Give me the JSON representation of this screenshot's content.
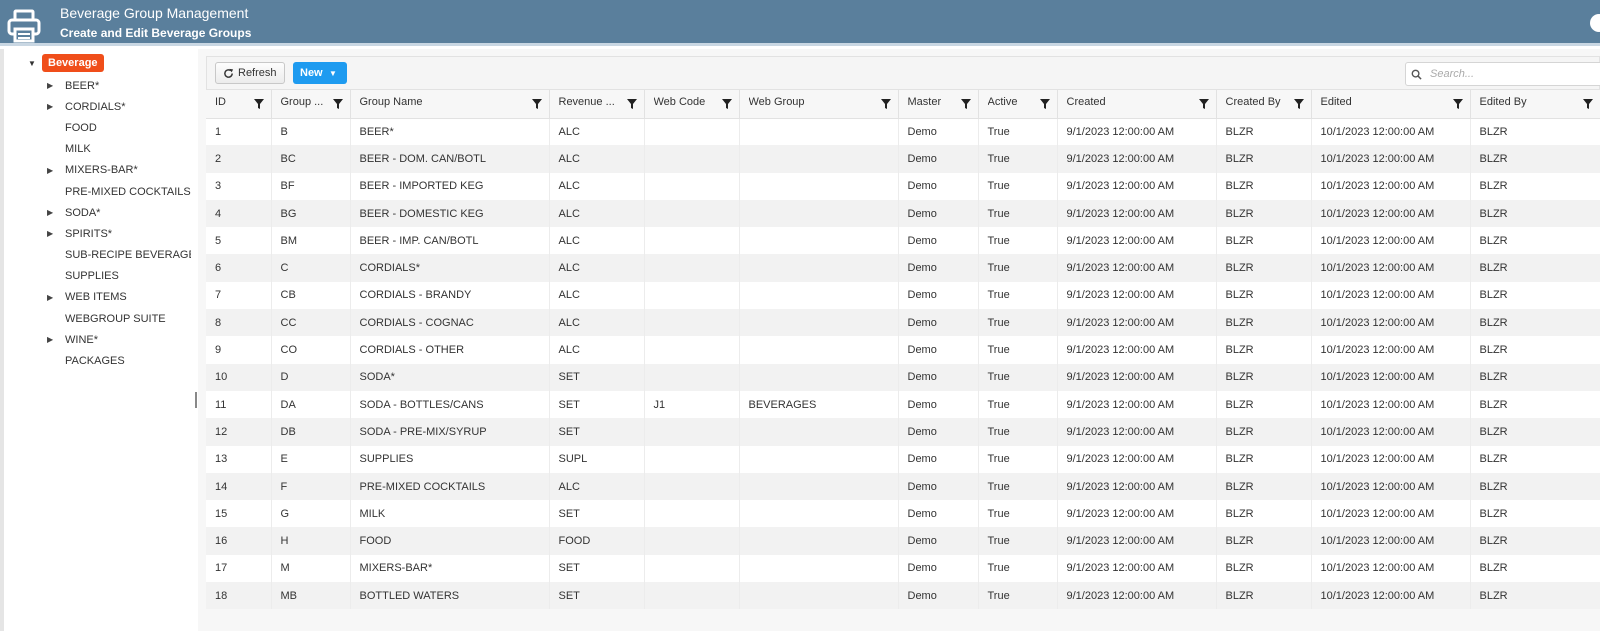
{
  "header": {
    "title": "Beverage Group Management",
    "subtitle": "Create and Edit Beverage Groups"
  },
  "tree": {
    "root_label": "Beverage",
    "items": [
      {
        "label": "BEER*",
        "expandable": true
      },
      {
        "label": "CORDIALS*",
        "expandable": true
      },
      {
        "label": "FOOD",
        "expandable": false
      },
      {
        "label": "MILK",
        "expandable": false
      },
      {
        "label": "MIXERS-BAR*",
        "expandable": true
      },
      {
        "label": "PRE-MIXED COCKTAILS",
        "expandable": false
      },
      {
        "label": "SODA*",
        "expandable": true
      },
      {
        "label": "SPIRITS*",
        "expandable": true
      },
      {
        "label": "SUB-RECIPE BEVERAGES",
        "expandable": false
      },
      {
        "label": "SUPPLIES",
        "expandable": false
      },
      {
        "label": "WEB ITEMS",
        "expandable": true
      },
      {
        "label": "WEBGROUP SUITE",
        "expandable": false
      },
      {
        "label": "WINE*",
        "expandable": true
      },
      {
        "label": "PACKAGES",
        "expandable": false
      }
    ]
  },
  "toolbar": {
    "refresh_label": "Refresh",
    "new_label": "New",
    "search_placeholder": "Search..."
  },
  "table": {
    "columns": [
      "ID",
      "Group ...",
      "Group Name",
      "Revenue ...",
      "Web Code",
      "Web Group",
      "Master",
      "Active",
      "Created",
      "Created By",
      "Edited",
      "Edited By"
    ],
    "rows": [
      [
        "1",
        "B",
        "BEER*",
        "ALC",
        "",
        "",
        "Demo",
        "True",
        "9/1/2023 12:00:00 AM",
        "BLZR",
        "10/1/2023 12:00:00 AM",
        "BLZR"
      ],
      [
        "2",
        "BC",
        "BEER - DOM. CAN/BOTL",
        "ALC",
        "",
        "",
        "Demo",
        "True",
        "9/1/2023 12:00:00 AM",
        "BLZR",
        "10/1/2023 12:00:00 AM",
        "BLZR"
      ],
      [
        "3",
        "BF",
        "BEER - IMPORTED KEG",
        "ALC",
        "",
        "",
        "Demo",
        "True",
        "9/1/2023 12:00:00 AM",
        "BLZR",
        "10/1/2023 12:00:00 AM",
        "BLZR"
      ],
      [
        "4",
        "BG",
        "BEER - DOMESTIC KEG",
        "ALC",
        "",
        "",
        "Demo",
        "True",
        "9/1/2023 12:00:00 AM",
        "BLZR",
        "10/1/2023 12:00:00 AM",
        "BLZR"
      ],
      [
        "5",
        "BM",
        "BEER - IMP. CAN/BOTL",
        "ALC",
        "",
        "",
        "Demo",
        "True",
        "9/1/2023 12:00:00 AM",
        "BLZR",
        "10/1/2023 12:00:00 AM",
        "BLZR"
      ],
      [
        "6",
        "C",
        "CORDIALS*",
        "ALC",
        "",
        "",
        "Demo",
        "True",
        "9/1/2023 12:00:00 AM",
        "BLZR",
        "10/1/2023 12:00:00 AM",
        "BLZR"
      ],
      [
        "7",
        "CB",
        "CORDIALS - BRANDY",
        "ALC",
        "",
        "",
        "Demo",
        "True",
        "9/1/2023 12:00:00 AM",
        "BLZR",
        "10/1/2023 12:00:00 AM",
        "BLZR"
      ],
      [
        "8",
        "CC",
        "CORDIALS - COGNAC",
        "ALC",
        "",
        "",
        "Demo",
        "True",
        "9/1/2023 12:00:00 AM",
        "BLZR",
        "10/1/2023 12:00:00 AM",
        "BLZR"
      ],
      [
        "9",
        "CO",
        "CORDIALS - OTHER",
        "ALC",
        "",
        "",
        "Demo",
        "True",
        "9/1/2023 12:00:00 AM",
        "BLZR",
        "10/1/2023 12:00:00 AM",
        "BLZR"
      ],
      [
        "10",
        "D",
        "SODA*",
        "SET",
        "",
        "",
        "Demo",
        "True",
        "9/1/2023 12:00:00 AM",
        "BLZR",
        "10/1/2023 12:00:00 AM",
        "BLZR"
      ],
      [
        "11",
        "DA",
        "SODA - BOTTLES/CANS",
        "SET",
        "J1",
        "BEVERAGES",
        "Demo",
        "True",
        "9/1/2023 12:00:00 AM",
        "BLZR",
        "10/1/2023 12:00:00 AM",
        "BLZR"
      ],
      [
        "12",
        "DB",
        "SODA - PRE-MIX/SYRUP",
        "SET",
        "",
        "",
        "Demo",
        "True",
        "9/1/2023 12:00:00 AM",
        "BLZR",
        "10/1/2023 12:00:00 AM",
        "BLZR"
      ],
      [
        "13",
        "E",
        "SUPPLIES",
        "SUPL",
        "",
        "",
        "Demo",
        "True",
        "9/1/2023 12:00:00 AM",
        "BLZR",
        "10/1/2023 12:00:00 AM",
        "BLZR"
      ],
      [
        "14",
        "F",
        "PRE-MIXED COCKTAILS",
        "ALC",
        "",
        "",
        "Demo",
        "True",
        "9/1/2023 12:00:00 AM",
        "BLZR",
        "10/1/2023 12:00:00 AM",
        "BLZR"
      ],
      [
        "15",
        "G",
        "MILK",
        "SET",
        "",
        "",
        "Demo",
        "True",
        "9/1/2023 12:00:00 AM",
        "BLZR",
        "10/1/2023 12:00:00 AM",
        "BLZR"
      ],
      [
        "16",
        "H",
        "FOOD",
        "FOOD",
        "",
        "",
        "Demo",
        "True",
        "9/1/2023 12:00:00 AM",
        "BLZR",
        "10/1/2023 12:00:00 AM",
        "BLZR"
      ],
      [
        "17",
        "M",
        "MIXERS-BAR*",
        "SET",
        "",
        "",
        "Demo",
        "True",
        "9/1/2023 12:00:00 AM",
        "BLZR",
        "10/1/2023 12:00:00 AM",
        "BLZR"
      ],
      [
        "18",
        "MB",
        "BOTTLED WATERS",
        "SET",
        "",
        "",
        "Demo",
        "True",
        "9/1/2023 12:00:00 AM",
        "BLZR",
        "10/1/2023 12:00:00 AM",
        "BLZR"
      ]
    ]
  },
  "icons": {
    "app": "printer-icon",
    "refresh": "refresh-icon",
    "search": "search-icon",
    "filter": "filter-icon",
    "expand": "caret-right-icon",
    "collapse": "caret-down-icon"
  },
  "colors": {
    "header_bg": "#5a7f9c",
    "root_badge": "#f04e1a",
    "new_button": "#1e9bf0"
  }
}
